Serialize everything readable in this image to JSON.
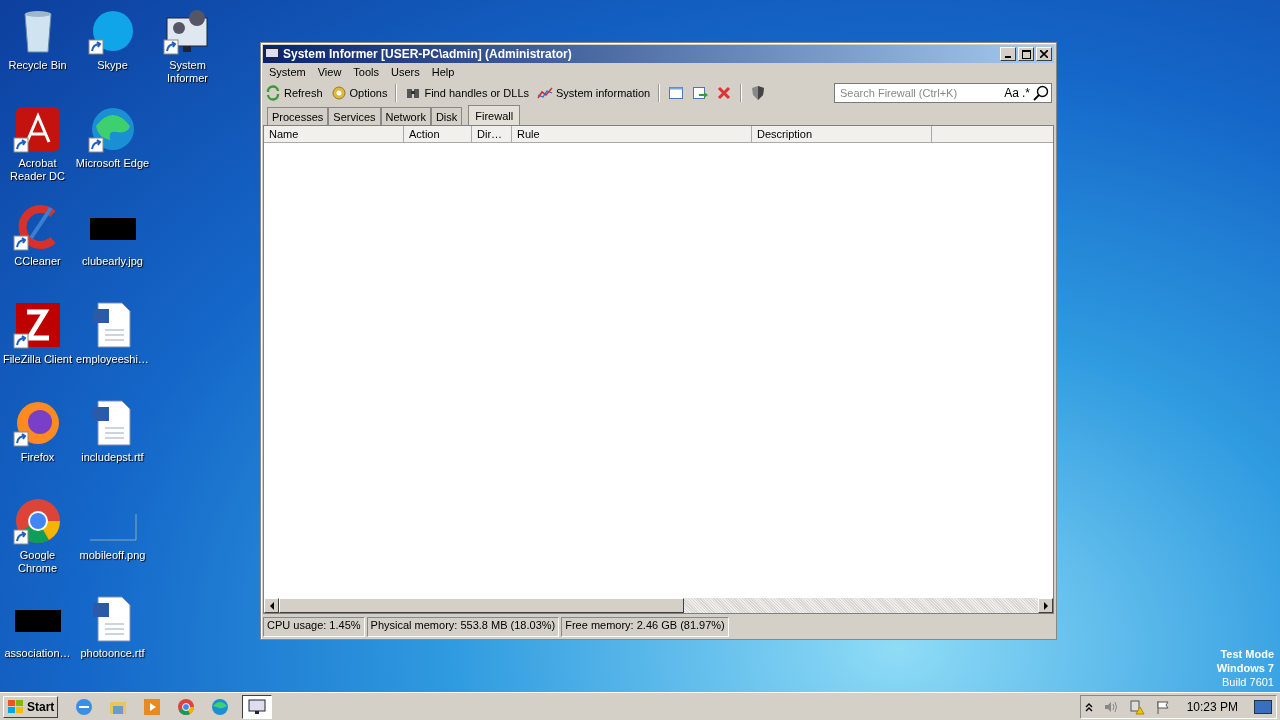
{
  "desktop": {
    "columns": [
      [
        {
          "label": "Recycle Bin",
          "kind": "bin",
          "shortcut": false
        },
        {
          "label": "Acrobat Reader DC",
          "kind": "acrobat",
          "shortcut": true
        },
        {
          "label": "CCleaner",
          "kind": "ccleaner",
          "shortcut": true
        },
        {
          "label": "FileZilla Client",
          "kind": "filezilla",
          "shortcut": true
        },
        {
          "label": "Firefox",
          "kind": "firefox",
          "shortcut": true
        },
        {
          "label": "Google Chrome",
          "kind": "chrome",
          "shortcut": true
        },
        {
          "label": "association…",
          "kind": "image",
          "shortcut": false
        }
      ],
      [
        {
          "label": "Skype",
          "kind": "skype",
          "shortcut": true
        },
        {
          "label": "Microsoft Edge",
          "kind": "edge",
          "shortcut": true
        },
        {
          "label": "clubearly.jpg",
          "kind": "image",
          "shortcut": false
        },
        {
          "label": "employeeshi…",
          "kind": "doc",
          "shortcut": false
        },
        {
          "label": "includepst.rtf",
          "kind": "doc",
          "shortcut": false
        },
        {
          "label": "mobileoff.png",
          "kind": "blank",
          "shortcut": false
        },
        {
          "label": "photoonce.rtf",
          "kind": "doc",
          "shortcut": false
        }
      ],
      [
        {
          "label": "System Informer",
          "kind": "sysinfo",
          "shortcut": true
        }
      ]
    ],
    "watermark": [
      "Test Mode",
      "Windows 7",
      "Build 7601"
    ]
  },
  "window": {
    "title": "System Informer [USER-PC\\admin] (Administrator)",
    "menu": [
      "System",
      "View",
      "Tools",
      "Users",
      "Help"
    ],
    "toolbar": [
      {
        "kind": "refresh",
        "label": "Refresh"
      },
      {
        "kind": "options",
        "label": "Options"
      },
      {
        "kind": "separator"
      },
      {
        "kind": "find",
        "label": "Find handles or DLLs"
      },
      {
        "kind": "chart",
        "label": "System information"
      },
      {
        "kind": "separator"
      },
      {
        "kind": "window"
      },
      {
        "kind": "go"
      },
      {
        "kind": "delete"
      },
      {
        "kind": "separator"
      },
      {
        "kind": "shield"
      }
    ],
    "search": {
      "placeholder": "Search Firewall (Ctrl+K)",
      "case_label": "Aa",
      "regex_label": ".*"
    },
    "tabs": [
      {
        "label": "Processes",
        "selected": false
      },
      {
        "label": "Services",
        "selected": false
      },
      {
        "label": "Network",
        "selected": false
      },
      {
        "label": "Disk",
        "selected": false
      },
      {
        "label": "Firewall",
        "selected": true
      }
    ],
    "table": {
      "columns": [
        "Name",
        "Action",
        "Dir…",
        "Rule",
        "Description"
      ]
    },
    "status_bar": [
      "CPU usage: 1.45%",
      "Physical memory: 553.8 MB (18.03%)",
      "Free memory: 2.46 GB (81.97%)"
    ]
  },
  "taskbar": {
    "start": "Start",
    "apps": [
      {
        "kind": "ie",
        "selected": false
      },
      {
        "kind": "folder",
        "selected": false
      },
      {
        "kind": "media",
        "selected": false
      },
      {
        "kind": "chrome",
        "selected": false
      },
      {
        "kind": "edge",
        "selected": false
      },
      {
        "kind": "sysinfo",
        "selected": true
      }
    ],
    "clock": "10:23 PM"
  }
}
